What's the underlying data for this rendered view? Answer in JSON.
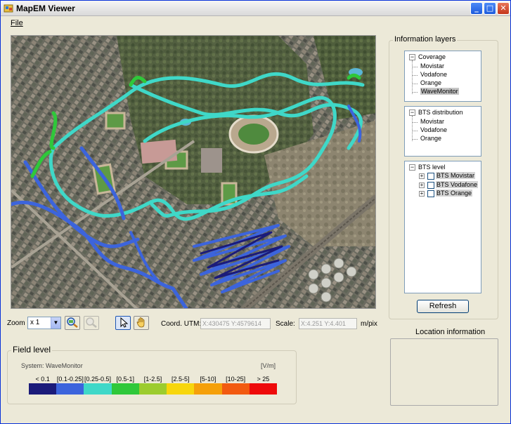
{
  "window": {
    "title": "MapEM Viewer"
  },
  "menu": {
    "file": "File"
  },
  "info_layers": {
    "title": "Information layers",
    "coverage": {
      "label": "Coverage",
      "items": [
        "Movistar",
        "Vodafone",
        "Orange",
        "WaveMonitor"
      ],
      "selected": "WaveMonitor"
    },
    "bts_distribution": {
      "label": "BTS distribution",
      "items": [
        "Movistar",
        "Vodafone",
        "Orange"
      ]
    },
    "bts_level": {
      "label": "BTS level",
      "items": [
        "BTS Movistar",
        "BTS Vodafone",
        "BTS Orange"
      ]
    },
    "refresh": "Refresh"
  },
  "location_info": {
    "title": "Location information"
  },
  "toolbar": {
    "zoom_label": "Zoom",
    "zoom_value": "x 1",
    "coord_label": "Coord. UTM:",
    "coord_value": "X:430475  Y:4579614",
    "scale_label": "Scale:",
    "scale_value": "X:4.251  Y:4.401",
    "scale_unit": "m/pix"
  },
  "field_level": {
    "title": "Field level",
    "system": "System: WaveMonitor",
    "unit": "[V/m]",
    "ranges": [
      "< 0.1",
      "[0.1-0.25]",
      "[0.25-0.5]",
      "[0.5-1]",
      "[1-2.5]",
      "[2.5-5]",
      "[5-10]",
      "[10-25]",
      "> 25"
    ],
    "colors": [
      "#1b1b7a",
      "#3c64dc",
      "#3fd8c8",
      "#2fc83a",
      "#9ccc2e",
      "#f7d60c",
      "#f5a00a",
      "#f25a10",
      "#ee0a0a"
    ]
  },
  "icons": {
    "app": "map-app-icon",
    "zoom_in": "zoom-map-icon",
    "zoom_out": "zoom-map-disabled-icon",
    "pointer": "pointer-arrow-icon",
    "pan": "pan-hand-icon"
  }
}
